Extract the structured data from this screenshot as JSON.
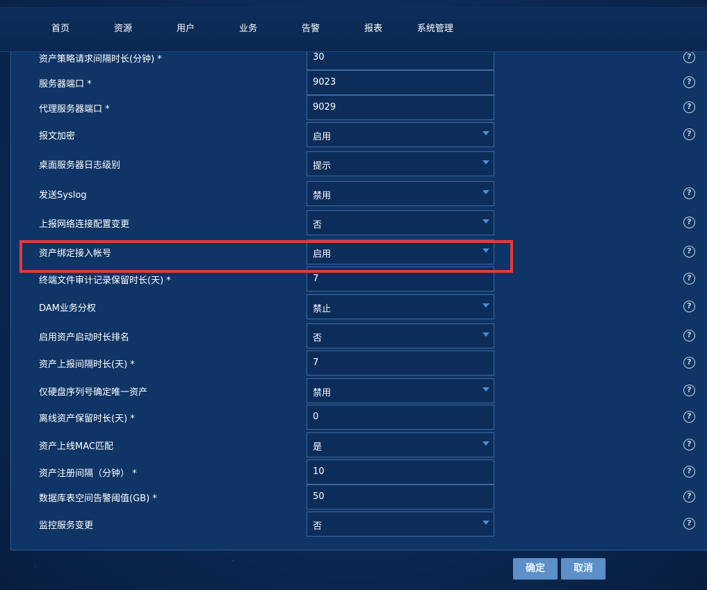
{
  "nav": {
    "items": [
      "首页",
      "资源",
      "用户",
      "业务",
      "告警",
      "报表",
      "系统管理"
    ]
  },
  "form": {
    "rows": [
      {
        "label": "资产策略请求间隔时长(分钟) *",
        "value": "30",
        "type": "input",
        "help": true
      },
      {
        "label": "服务器端口 *",
        "value": "9023",
        "type": "input",
        "help": true
      },
      {
        "label": "代理服务器端口 *",
        "value": "9029",
        "type": "input",
        "help": true
      },
      {
        "label": "报文加密",
        "value": "启用",
        "type": "select",
        "help": true
      },
      {
        "label": "桌面服务器日志级别",
        "value": "提示",
        "type": "select",
        "help": false
      },
      {
        "label": "发送Syslog",
        "value": "禁用",
        "type": "select",
        "help": true
      },
      {
        "label": "上报网络连接配置变更",
        "value": "否",
        "type": "select",
        "help": true
      },
      {
        "label": "资产绑定接入帐号",
        "value": "启用",
        "type": "select",
        "help": true
      },
      {
        "label": "终端文件审计记录保留时长(天) *",
        "value": "7",
        "type": "input",
        "help": true
      },
      {
        "label": "DAM业务分权",
        "value": "禁止",
        "type": "select",
        "help": true
      },
      {
        "label": "启用资产启动时长排名",
        "value": "否",
        "type": "select",
        "help": true
      },
      {
        "label": "资产上报间隔时长(天) *",
        "value": "7",
        "type": "input",
        "help": true
      },
      {
        "label": "仅硬盘序列号确定唯一资产",
        "value": "禁用",
        "type": "select",
        "help": true
      },
      {
        "label": "离线资产保留时长(天) *",
        "value": "0",
        "type": "input",
        "help": true
      },
      {
        "label": "资产上线MAC匹配",
        "value": "是",
        "type": "select",
        "help": true
      },
      {
        "label": "资产注册间隔（分钟） *",
        "value": "10",
        "type": "input",
        "help": true
      },
      {
        "label": "数据库表空间告警阈值(GB) *",
        "value": "50",
        "type": "input",
        "help": true
      },
      {
        "label": "监控服务变更",
        "value": "否",
        "type": "select",
        "help": true
      }
    ],
    "help_glyph": "?"
  },
  "actions": {
    "confirm_label": "确定",
    "cancel_label": "取消"
  },
  "colors": {
    "background": "#0c2a55",
    "panel": "#0f3566",
    "field_border": "#3c6aa3",
    "highlight": "#e23b3b",
    "button": "#5d8fc8"
  }
}
